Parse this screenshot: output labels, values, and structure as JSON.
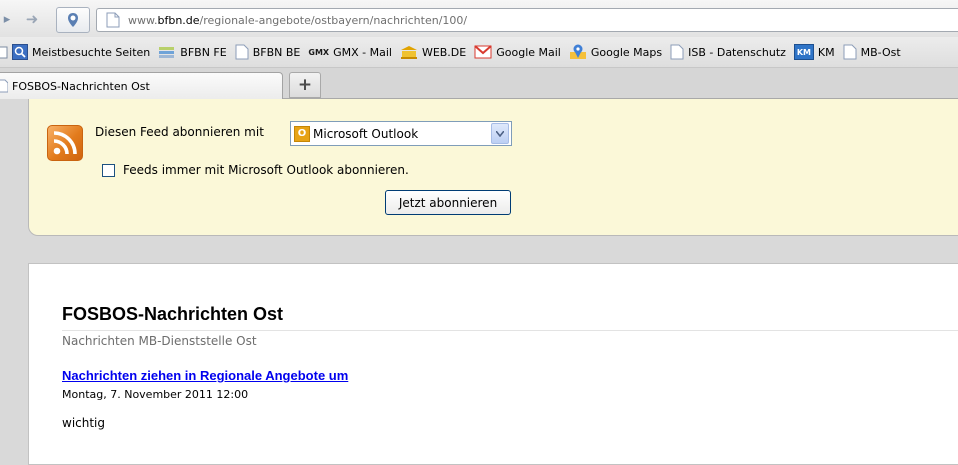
{
  "browser": {
    "url_prefix": "www.",
    "url_domain": "bfbn.de",
    "url_path": "/regionale-angebote/ostbayern/nachrichten/100/"
  },
  "bookmarks": [
    {
      "label": "Meistbesuchte Seiten",
      "icon": "search-icon"
    },
    {
      "label": "BFBN FE",
      "icon": "stack-icon"
    },
    {
      "label": "BFBN BE",
      "icon": "page-icon"
    },
    {
      "label": "GMX - Mail",
      "icon": "gmx-icon",
      "icon_text": "GMX"
    },
    {
      "label": "WEB.DE",
      "icon": "webde-icon"
    },
    {
      "label": "Google Mail",
      "icon": "gmail-icon"
    },
    {
      "label": "Google Maps",
      "icon": "maps-pin-icon"
    },
    {
      "label": "ISB - Datenschutz",
      "icon": "page-icon"
    },
    {
      "label": "KM",
      "icon": "km-icon",
      "icon_text": "KM"
    },
    {
      "label": "MB-Ost",
      "icon": "page-icon"
    }
  ],
  "tabs": [
    {
      "label": "FOSBOS-Nachrichten Ost"
    }
  ],
  "new_tab_symbol": "+",
  "feed": {
    "label": "Diesen Feed abonnieren mit",
    "reader_icon_text": "O",
    "reader_selected": "Microsoft Outlook",
    "always_label": "Feeds immer mit Microsoft Outlook abonnieren.",
    "always_checked": false,
    "button_label": "Jetzt abonnieren"
  },
  "page": {
    "title": "FOSBOS-Nachrichten Ost",
    "subtitle": "Nachrichten MB-Dienststelle Ost",
    "entries": [
      {
        "title": "Nachrichten ziehen in Regionale Angebote um",
        "date": "Montag, 7. November 2011 12:00",
        "text": "wichtig"
      }
    ]
  },
  "colors": {
    "feed_background": "#fbf8d8",
    "link": "#0000ee",
    "rss_orange": "#e27b1c"
  }
}
